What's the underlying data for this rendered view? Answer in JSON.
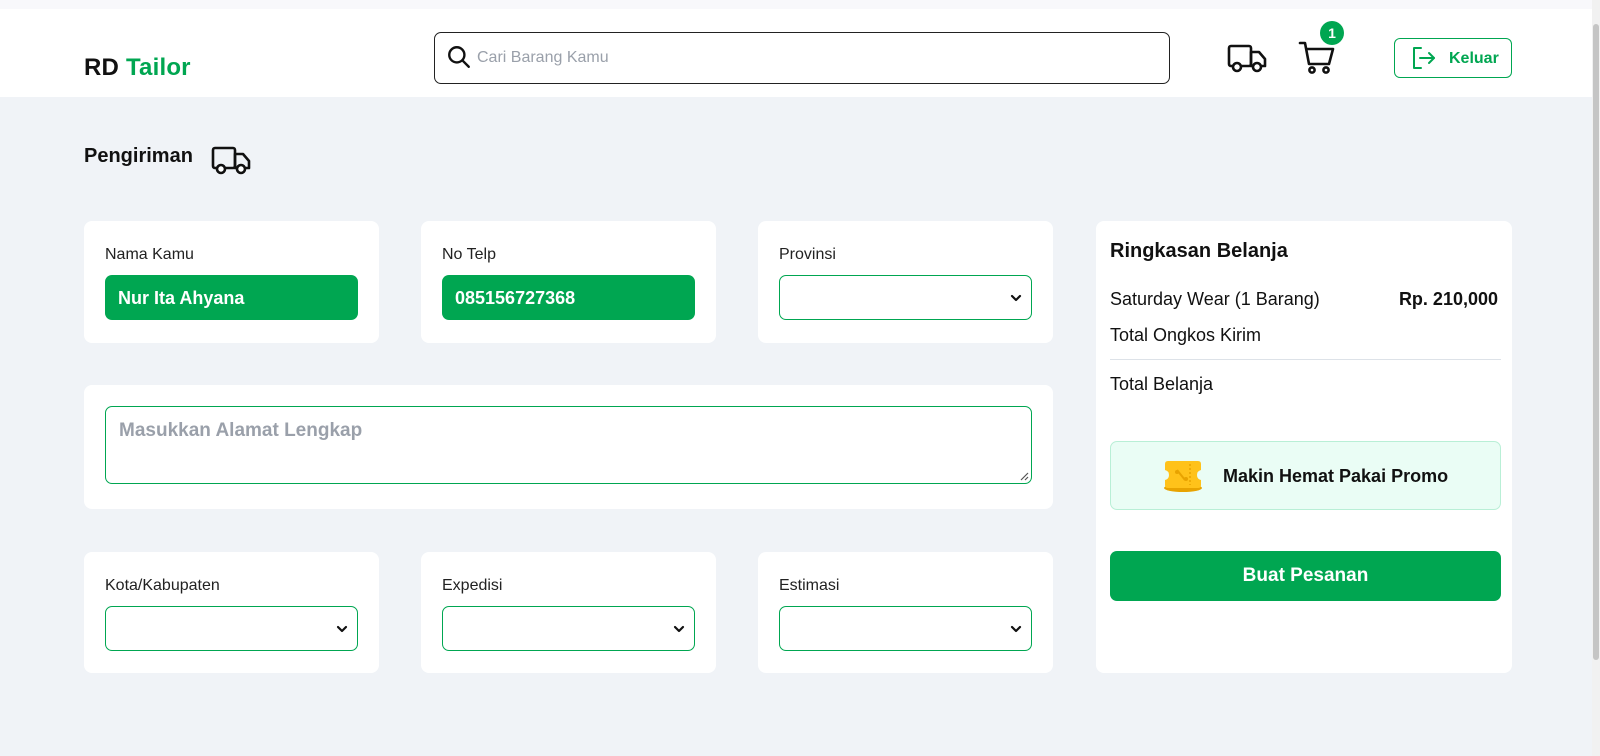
{
  "header": {
    "logo_part1": "RD",
    "logo_part2": "Tailor",
    "search_placeholder": "Cari Barang Kamu",
    "cart_count": "1",
    "logout_label": "Keluar"
  },
  "page": {
    "title": "Pengiriman"
  },
  "form": {
    "name_label": "Nama Kamu",
    "name_value": "Nur Ita Ahyana",
    "phone_label": "No Telp",
    "phone_value": "085156727368",
    "province_label": "Provinsi",
    "province_value": "",
    "address_placeholder": "Masukkan Alamat Lengkap",
    "city_label": "Kota/Kabupaten",
    "city_value": "",
    "courier_label": "Expedisi",
    "courier_value": "",
    "estimate_label": "Estimasi",
    "estimate_value": ""
  },
  "summary": {
    "title": "Ringkasan Belanja",
    "item_label": "Saturday Wear (1 Barang)",
    "item_price": "Rp. 210,000",
    "shipping_label": "Total Ongkos Kirim",
    "total_label": "Total Belanja",
    "promo_label": "Makin Hemat Pakai Promo",
    "order_button": "Buat Pesanan"
  },
  "colors": {
    "accent": "#00a651",
    "background": "#f0f3f7",
    "promo_bg": "#eafdf5"
  },
  "icons": {
    "search": "search-icon",
    "truck": "truck-icon",
    "cart": "cart-icon",
    "logout": "logout-icon",
    "promo": "promo-ticket-icon",
    "dropdown": "chevron-down-icon"
  }
}
